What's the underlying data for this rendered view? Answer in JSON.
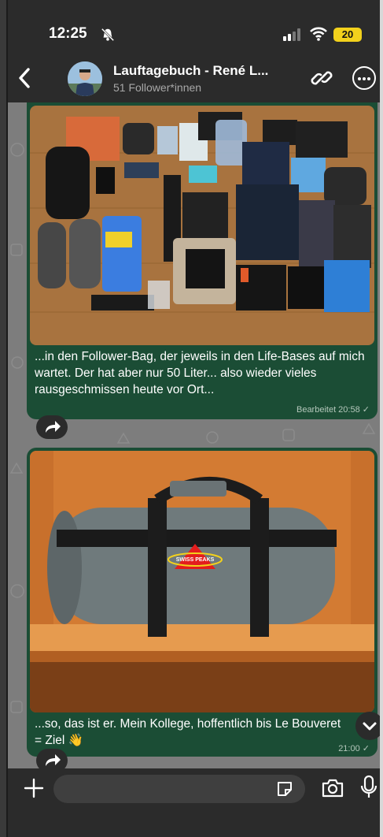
{
  "status_bar": {
    "time": "12:25",
    "battery": "20"
  },
  "header": {
    "title": "Lauftagebuch - René L...",
    "subtitle": "51 Follower*innen"
  },
  "messages": [
    {
      "caption": "...in den Follower-Bag, der jeweils in den Life-Bases auf mich wartet. Der hat aber nur 50 Liter... also wieder vieles rausgeschmissen heute vor Ort...",
      "meta": "Bearbeitet 20:58 ✓"
    },
    {
      "caption": "...so, das ist er. Mein Kollege, hoffentlich bis Le Bouveret = Ziel 👋",
      "meta": "21:00 ✓",
      "bag_logo": "SWISS PEAKS"
    }
  ],
  "colors": {
    "bubble": "#1b4d35",
    "bar": "#2b2b2b",
    "battery": "#f2d11c",
    "wallpaper": "#7d7d7d"
  }
}
